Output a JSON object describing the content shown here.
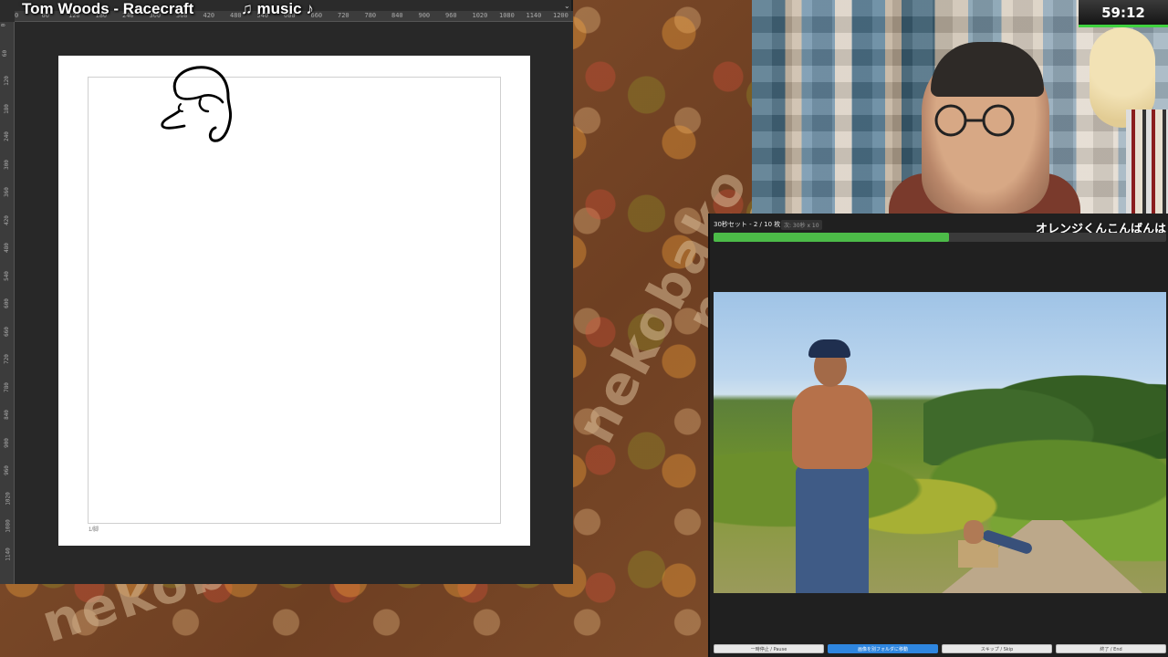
{
  "overlay": {
    "song_title": "Tom Woods - Racecraft",
    "music_label": "♫ music ♪"
  },
  "drawing_app": {
    "ruler_top_ticks": [
      "0",
      "60",
      "120",
      "180",
      "240",
      "300",
      "360",
      "420",
      "480",
      "540",
      "600",
      "660",
      "720",
      "780",
      "840",
      "900",
      "960",
      "1020",
      "1080",
      "1140",
      "1200"
    ],
    "ruler_left_ticks": [
      "0",
      "60",
      "120",
      "180",
      "240",
      "300",
      "360",
      "420",
      "480",
      "540",
      "600",
      "660",
      "720",
      "780",
      "840",
      "900",
      "960",
      "1020",
      "1080",
      "1140"
    ],
    "corner_mark": "1/脚"
  },
  "stream": {
    "timer": "59:12",
    "background_word": "nekobako"
  },
  "practice": {
    "set_label": "30秒セット - 2 / 10 枚目",
    "set_sub": "次: 30秒 x 10",
    "greeting": "オレンジくんこんばんは",
    "progress": 0.52,
    "buttons": [
      "一時停止 / Pause",
      "画像を別フォルダに移動",
      "スキップ / Skip",
      "終了 / End"
    ]
  },
  "colors": {
    "progress_green": "#4cbb48",
    "primary_button_blue": "#2e86e0",
    "timer_underline": "#3fd23f"
  }
}
